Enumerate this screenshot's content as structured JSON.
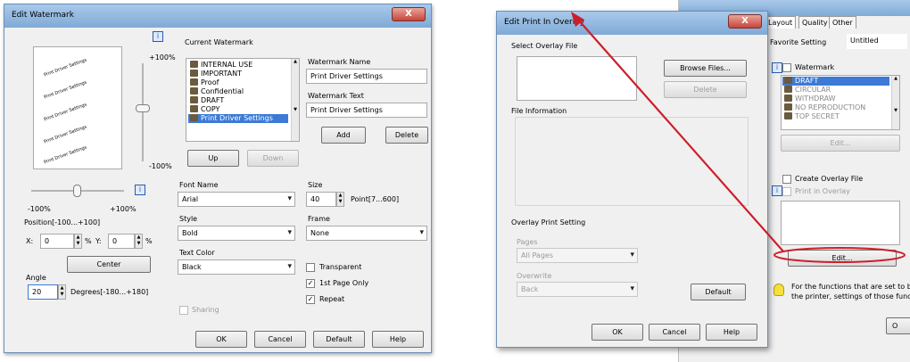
{
  "left_dialog": {
    "title": "Edit Watermark",
    "close_label": "X",
    "preview_text": "Print Driver Settings",
    "pct_top": "+100%",
    "pct_bottom": "-100%",
    "pct_left": "-100%",
    "pct_right": "+100%",
    "current_watermark_label": "Current Watermark",
    "watermarks": [
      "INTERNAL USE",
      "IMPORTANT",
      "Proof",
      "Confidential",
      "DRAFT",
      "COPY",
      "Print Driver Settings"
    ],
    "up_label": "Up",
    "down_label": "Down",
    "wm_name_label": "Watermark Name",
    "wm_name_value": "Print Driver Settings",
    "wm_text_label": "Watermark Text",
    "wm_text_value": "Print Driver Settings",
    "add_label": "Add",
    "delete_label": "Delete",
    "position_label": "Position[-100...+100]",
    "x_label": "X:",
    "x_value": "0",
    "y_label": "Y:",
    "y_value": "0",
    "pct": "%",
    "center_label": "Center",
    "angle_label": "Angle",
    "angle_value": "20",
    "angle_range": "Degrees[-180...+180]",
    "font_name_label": "Font Name",
    "font_name_value": "Arial",
    "size_label": "Size",
    "size_value": "40",
    "size_range": "Point[7...600]",
    "style_label": "Style",
    "style_value": "Bold",
    "frame_label": "Frame",
    "frame_value": "None",
    "text_color_label": "Text Color",
    "text_color_value": "Black",
    "transparent_label": "Transparent",
    "first_page_label": "1st Page Only",
    "repeat_label": "Repeat",
    "sharing_label": "Sharing",
    "ok": "OK",
    "cancel": "Cancel",
    "default": "Default",
    "help": "Help"
  },
  "overlay_dialog": {
    "title": "Edit Print In Overlay",
    "close_label": "X",
    "select_overlay_label": "Select Overlay File",
    "browse_label": "Browse Files...",
    "delete_label": "Delete",
    "file_info_label": "File Information",
    "overlay_print_label": "Overlay Print Setting",
    "pages_label": "Pages",
    "pages_value": "All Pages",
    "overwrite_label": "Overwrite",
    "overwrite_value": "Back",
    "default": "Default",
    "ok": "OK",
    "cancel": "Cancel",
    "help": "Help"
  },
  "back_dialog": {
    "tabs": [
      "Layout",
      "Quality",
      "Other"
    ],
    "fav_label": "Favorite Setting",
    "fav_value": "Untitled",
    "watermark_label": "Watermark",
    "watermarks": [
      "DRAFT",
      "CIRCULAR",
      "WITHDRAW",
      "NO REPRODUCTION",
      "TOP SECRET"
    ],
    "edit_label": "Edit...",
    "create_overlay_label": "Create Overlay File",
    "print_in_overlay_label": "Print in Overlay",
    "edit2_label": "Edit...",
    "note": "For the functions that are set to be\nthe printer, settings of those functio",
    "ok": "O"
  },
  "colors": {
    "accent": "#cc1f2b",
    "selection": "#3c7ad6",
    "titlebar": "#8fb5de"
  }
}
